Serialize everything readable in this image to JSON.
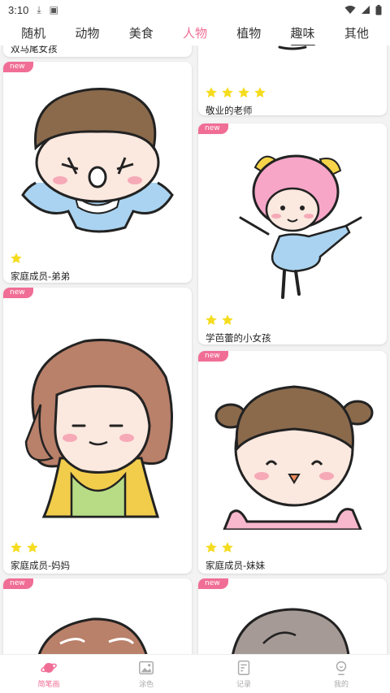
{
  "status": {
    "time": "3:10"
  },
  "tabs": [
    {
      "label": "随机"
    },
    {
      "label": "动物"
    },
    {
      "label": "美食"
    },
    {
      "label": "人物"
    },
    {
      "label": "植物"
    },
    {
      "label": "趣味"
    },
    {
      "label": "其他"
    }
  ],
  "active_tab_color": "#f06e96",
  "cards": {
    "c0": {
      "title": "双马尾女孩"
    },
    "c1": {
      "badge": "new",
      "title": "敬业的老师",
      "stars": 4
    },
    "c2": {
      "badge": "new",
      "title": "家庭成员-弟弟",
      "stars": 1
    },
    "c3": {
      "badge": "new",
      "title": "学芭蕾的小女孩",
      "stars": 2
    },
    "c4": {
      "badge": "new",
      "title": "家庭成员-妈妈",
      "stars": 2
    },
    "c5": {
      "badge": "new",
      "title": "家庭成员-妹妹",
      "stars": 2
    },
    "c6": {
      "badge": "new"
    },
    "c7": {
      "badge": "new"
    }
  },
  "star_color": "#f5dc1e",
  "bottom_nav": [
    {
      "label": "简笔画",
      "icon": "planet-icon"
    },
    {
      "label": "涂色",
      "icon": "image-icon"
    },
    {
      "label": "记录",
      "icon": "document-icon"
    },
    {
      "label": "我的",
      "icon": "profile-icon"
    }
  ]
}
